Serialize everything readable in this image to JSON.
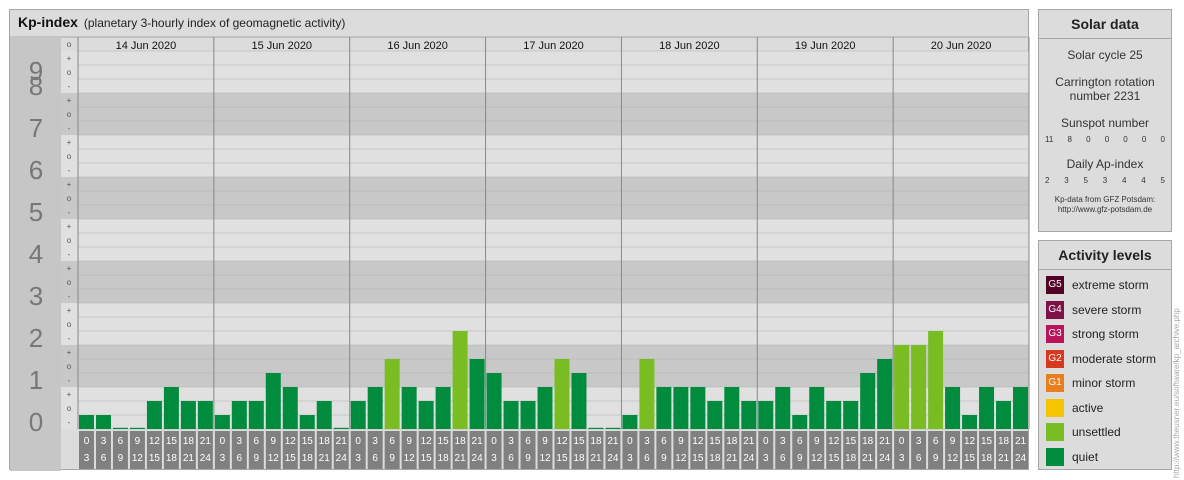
{
  "header": {
    "title": "Kp-index",
    "subtitle": "(planetary 3-hourly index of geomagnetic activity)"
  },
  "y_tick_labels": [
    "0",
    "1",
    "2",
    "3",
    "4",
    "5",
    "6",
    "7",
    "8",
    "9"
  ],
  "sub_tick_labels": [
    "-",
    "o",
    "+"
  ],
  "hour_labels": [
    {
      "top": "0",
      "bottom": "3"
    },
    {
      "top": "3",
      "bottom": "6"
    },
    {
      "top": "6",
      "bottom": "9"
    },
    {
      "top": "9",
      "bottom": "12"
    },
    {
      "top": "12",
      "bottom": "15"
    },
    {
      "top": "15",
      "bottom": "18"
    },
    {
      "top": "18",
      "bottom": "21"
    },
    {
      "top": "21",
      "bottom": "24"
    }
  ],
  "colors": {
    "quiet": "#008c3c",
    "unsettled": "#79bd23",
    "active": "#f5c400",
    "minor": "#e87e1d",
    "moderate": "#d6391e",
    "strong": "#b8145a",
    "severe": "#7c1248",
    "extreme": "#520426",
    "band_dark": "#c8c8c8",
    "band_light": "#e0e0e0",
    "grid": "#b0b0b0",
    "hour_box": "#808080"
  },
  "chart_data": {
    "type": "bar",
    "title": "Kp-index",
    "subtitle": "(planetary 3-hourly index of geomagnetic activity)",
    "xlabel": "",
    "ylabel": "",
    "ylim": [
      0,
      9
    ],
    "grid": true,
    "categories": [
      "14 Jun 2020",
      "15 Jun 2020",
      "16 Jun 2020",
      "17 Jun 2020",
      "18 Jun 2020",
      "19 Jun 2020",
      "20 Jun 2020"
    ],
    "intervals_per_day": 8,
    "values": [
      [
        0.333,
        0.333,
        0.0,
        0.0,
        0.667,
        1.0,
        0.667,
        0.667
      ],
      [
        0.333,
        0.667,
        0.667,
        1.333,
        1.0,
        0.333,
        0.667,
        0.0
      ],
      [
        0.667,
        1.0,
        1.667,
        1.0,
        0.667,
        1.0,
        2.333,
        1.667
      ],
      [
        1.333,
        0.667,
        0.667,
        1.0,
        1.667,
        1.333,
        0.0,
        0.0
      ],
      [
        0.333,
        1.667,
        1.0,
        1.0,
        1.0,
        0.667,
        1.0,
        0.667
      ],
      [
        0.667,
        1.0,
        0.333,
        1.0,
        0.667,
        0.667,
        1.333,
        1.667
      ],
      [
        2.0,
        2.0,
        2.333,
        1.0,
        0.333,
        1.0,
        0.667,
        1.0
      ]
    ],
    "levels": [
      [
        0,
        0,
        0,
        0,
        0,
        0,
        0,
        0
      ],
      [
        0,
        0,
        0,
        0,
        0,
        0,
        0,
        0
      ],
      [
        0,
        0,
        1,
        0,
        0,
        0,
        1,
        0
      ],
      [
        0,
        0,
        0,
        0,
        1,
        0,
        0,
        0
      ],
      [
        0,
        1,
        0,
        0,
        0,
        0,
        0,
        0
      ],
      [
        0,
        0,
        0,
        0,
        0,
        0,
        0,
        0
      ],
      [
        1,
        1,
        1,
        0,
        0,
        0,
        0,
        0
      ]
    ]
  },
  "solar": {
    "title": "Solar data",
    "cycle": "Solar cycle 25",
    "carrington_line1": "Carrington rotation",
    "carrington_line2": "number 2231",
    "sunspot_title": "Sunspot number",
    "sunspot_values": [
      "11",
      "8",
      "0",
      "0",
      "0",
      "0",
      "0"
    ],
    "ap_title": "Daily Ap-index",
    "ap_values": [
      "2",
      "3",
      "5",
      "3",
      "4",
      "4",
      "5"
    ],
    "credit_line1": "Kp-data from GFZ Potsdam:",
    "credit_line2": "http://www.gfz-potsdam.de"
  },
  "activity": {
    "title": "Activity levels",
    "items": [
      {
        "badge": "G5",
        "label": "extreme storm",
        "color": "#520426"
      },
      {
        "badge": "G4",
        "label": "severe storm",
        "color": "#7c1248"
      },
      {
        "badge": "G3",
        "label": "strong storm",
        "color": "#b8145a"
      },
      {
        "badge": "G2",
        "label": "moderate storm",
        "color": "#d6391e"
      },
      {
        "badge": "G1",
        "label": "minor storm",
        "color": "#e87e1d"
      },
      {
        "badge": "",
        "label": "active",
        "color": "#f5c400"
      },
      {
        "badge": "",
        "label": "unsettled",
        "color": "#79bd23"
      },
      {
        "badge": "",
        "label": "quiet",
        "color": "#008c3c"
      }
    ]
  },
  "watermark": "http://www.theusner.eu/software/kp_archive.php"
}
